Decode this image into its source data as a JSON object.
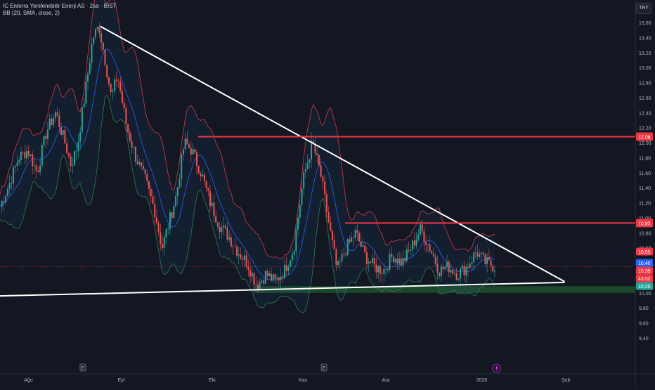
{
  "header": {
    "title": "IC Enterra Yenilenebilir Enerji AS · 2sa · BIST",
    "indicator": "BB (20, SMA, close, 2)"
  },
  "currency": "TRY",
  "colors": {
    "background": "#131722",
    "up": "#26a69a",
    "down": "#ef5350",
    "bb_basis": "#2962ff",
    "bb_upper": "#d5384a",
    "bb_lower": "#2e7d4f",
    "resistance": "#f23645",
    "trendline": "#ffffff",
    "support_zone": "#1f4d2b"
  },
  "chart_data": {
    "type": "candlestick",
    "x_ticks": [
      "Ağu",
      "Eyl",
      "Eki",
      "Kas",
      "Ara",
      "2026",
      "Şub"
    ],
    "y_ticks": [
      "13,60",
      "13,40",
      "13,20",
      "13,00",
      "12,80",
      "12,60",
      "12,40",
      "12,20",
      "12,00",
      "11,80",
      "11,60",
      "11,40",
      "11,20",
      "11,00",
      "10,80",
      "10,60",
      "10,40",
      "10,20",
      "10,00",
      "9,80",
      "9,60",
      "9,40"
    ],
    "ylim": [
      9.4,
      13.6
    ],
    "resistance_levels": [
      {
        "label": "12,08",
        "value": 12.08
      },
      {
        "label": "10,93",
        "value": 10.93
      }
    ],
    "support_zone": [
      10.0,
      10.09
    ],
    "price_labels": [
      {
        "label": "10,55",
        "value": 10.55,
        "color": "#f23645"
      },
      {
        "label": "10,40",
        "value": 10.4,
        "color": "#2962ff"
      },
      {
        "label": "10,35",
        "value": 10.35,
        "color": "#f23645"
      },
      {
        "label": "43:52",
        "value": 10.28,
        "color": "#f23645"
      },
      {
        "label": "10,25",
        "value": 10.23,
        "color": "#26a69a"
      }
    ],
    "last_price": 10.35,
    "event_markers": [
      {
        "label": "E",
        "at": "Eyl"
      },
      {
        "label": "E",
        "at": "Kas"
      }
    ],
    "price_path": [
      {
        "t": 0.0,
        "p": 11.15
      },
      {
        "t": 0.015,
        "p": 11.45
      },
      {
        "t": 0.03,
        "p": 11.8
      },
      {
        "t": 0.045,
        "p": 11.9
      },
      {
        "t": 0.06,
        "p": 11.6
      },
      {
        "t": 0.075,
        "p": 12.15
      },
      {
        "t": 0.09,
        "p": 12.4
      },
      {
        "t": 0.105,
        "p": 12.0
      },
      {
        "t": 0.115,
        "p": 11.7
      },
      {
        "t": 0.125,
        "p": 11.95
      },
      {
        "t": 0.14,
        "p": 12.8
      },
      {
        "t": 0.15,
        "p": 13.4
      },
      {
        "t": 0.16,
        "p": 13.55
      },
      {
        "t": 0.17,
        "p": 13.1
      },
      {
        "t": 0.18,
        "p": 12.6
      },
      {
        "t": 0.19,
        "p": 12.9
      },
      {
        "t": 0.205,
        "p": 12.2
      },
      {
        "t": 0.22,
        "p": 11.8
      },
      {
        "t": 0.235,
        "p": 11.5
      },
      {
        "t": 0.25,
        "p": 11.1
      },
      {
        "t": 0.262,
        "p": 10.6
      },
      {
        "t": 0.272,
        "p": 10.9
      },
      {
        "t": 0.285,
        "p": 11.3
      },
      {
        "t": 0.298,
        "p": 12.0
      },
      {
        "t": 0.31,
        "p": 11.9
      },
      {
        "t": 0.325,
        "p": 11.6
      },
      {
        "t": 0.34,
        "p": 11.2
      },
      {
        "t": 0.355,
        "p": 10.9
      },
      {
        "t": 0.37,
        "p": 10.75
      },
      {
        "t": 0.385,
        "p": 10.55
      },
      {
        "t": 0.4,
        "p": 10.4
      },
      {
        "t": 0.415,
        "p": 10.1
      },
      {
        "t": 0.43,
        "p": 10.25
      },
      {
        "t": 0.445,
        "p": 10.15
      },
      {
        "t": 0.46,
        "p": 10.3
      },
      {
        "t": 0.475,
        "p": 10.6
      },
      {
        "t": 0.49,
        "p": 11.5
      },
      {
        "t": 0.505,
        "p": 12.0
      },
      {
        "t": 0.518,
        "p": 11.6
      },
      {
        "t": 0.53,
        "p": 11.0
      },
      {
        "t": 0.545,
        "p": 10.3
      },
      {
        "t": 0.56,
        "p": 10.6
      },
      {
        "t": 0.575,
        "p": 10.8
      },
      {
        "t": 0.59,
        "p": 10.5
      },
      {
        "t": 0.605,
        "p": 10.35
      },
      {
        "t": 0.62,
        "p": 10.3
      },
      {
        "t": 0.635,
        "p": 10.5
      },
      {
        "t": 0.65,
        "p": 10.4
      },
      {
        "t": 0.665,
        "p": 10.6
      },
      {
        "t": 0.68,
        "p": 10.85
      },
      {
        "t": 0.695,
        "p": 10.6
      },
      {
        "t": 0.71,
        "p": 10.3
      },
      {
        "t": 0.725,
        "p": 10.35
      },
      {
        "t": 0.74,
        "p": 10.25
      },
      {
        "t": 0.755,
        "p": 10.35
      },
      {
        "t": 0.77,
        "p": 10.55
      },
      {
        "t": 0.785,
        "p": 10.4
      },
      {
        "t": 0.8,
        "p": 10.35
      }
    ]
  },
  "toolbar_icons": [
    "lightning-icon"
  ]
}
